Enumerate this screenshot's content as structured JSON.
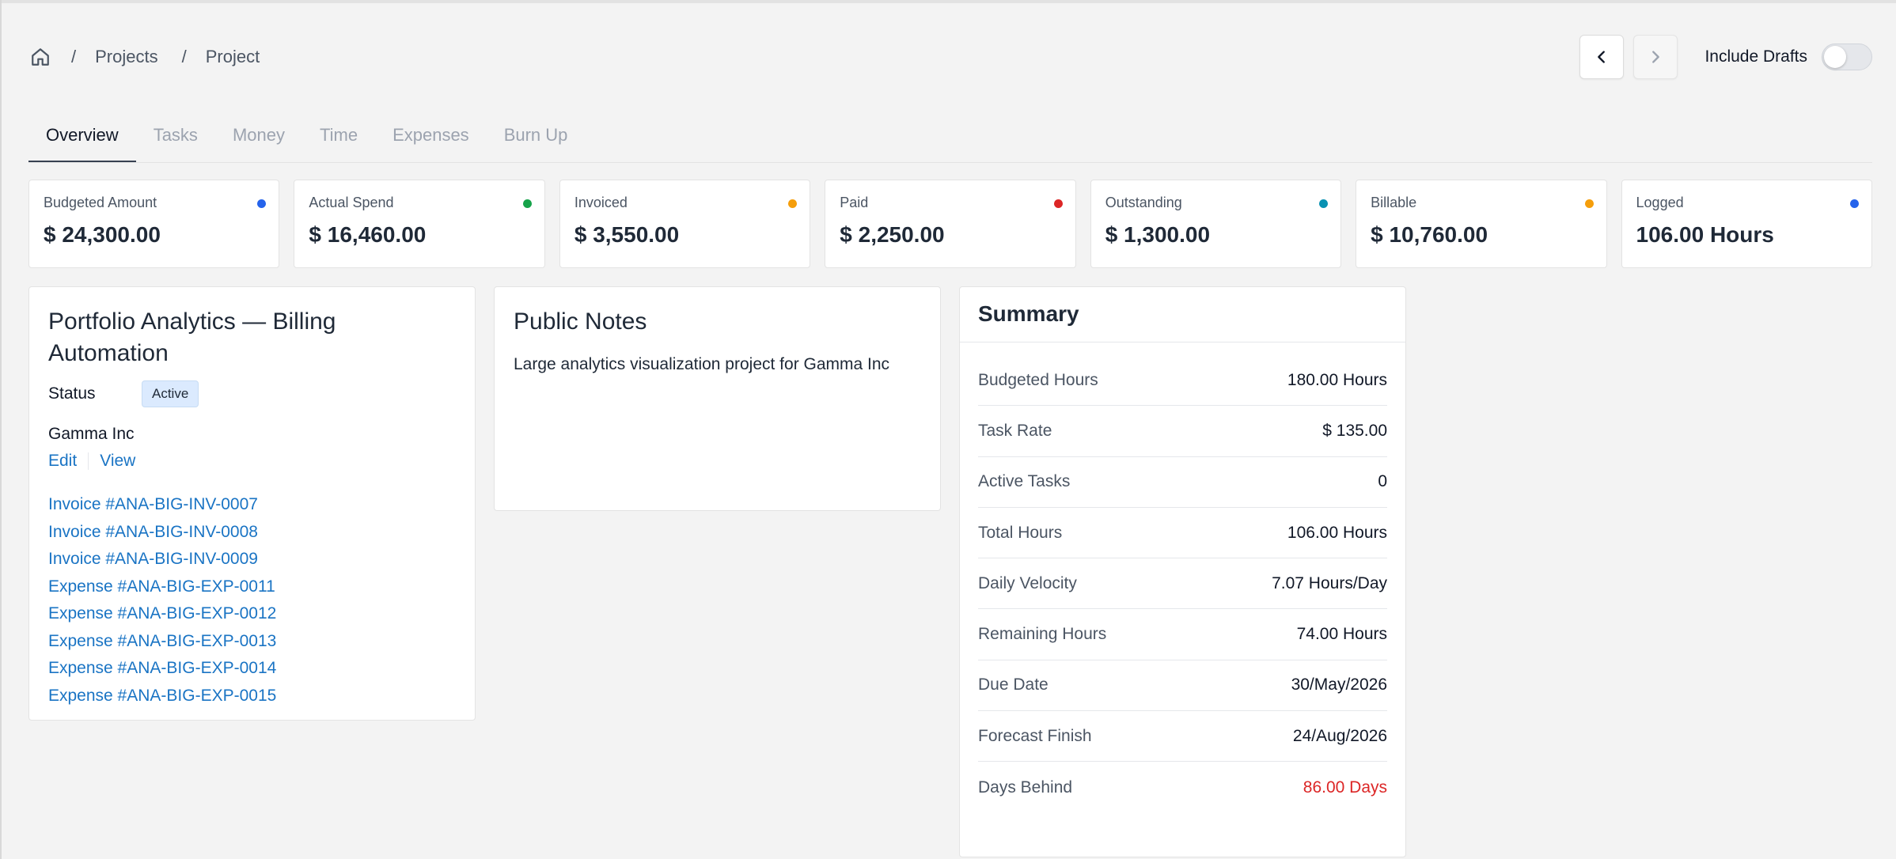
{
  "breadcrumb": {
    "home_icon": "home-icon",
    "separator": "/",
    "projects": "Projects",
    "current": "Project"
  },
  "header": {
    "prev_icon": "chevron-left-icon",
    "next_icon": "chevron-right-icon",
    "include_drafts_label": "Include Drafts",
    "include_drafts_on": false
  },
  "tabs": [
    {
      "label": "Overview",
      "active": true
    },
    {
      "label": "Tasks",
      "active": false
    },
    {
      "label": "Money",
      "active": false
    },
    {
      "label": "Time",
      "active": false
    },
    {
      "label": "Expenses",
      "active": false
    },
    {
      "label": "Burn Up",
      "active": false
    }
  ],
  "stats": [
    {
      "label": "Budgeted Amount",
      "value": "$ 24,300.00",
      "dot_color": "#2563eb"
    },
    {
      "label": "Actual Spend",
      "value": "$ 16,460.00",
      "dot_color": "#16a34a"
    },
    {
      "label": "Invoiced",
      "value": "$ 3,550.00",
      "dot_color": "#f59e0b"
    },
    {
      "label": "Paid",
      "value": "$ 2,250.00",
      "dot_color": "#dc2626"
    },
    {
      "label": "Outstanding",
      "value": "$ 1,300.00",
      "dot_color": "#0891b2"
    },
    {
      "label": "Billable",
      "value": "$ 10,760.00",
      "dot_color": "#f59e0b"
    },
    {
      "label": "Logged",
      "value": "106.00 Hours",
      "dot_color": "#2563eb"
    }
  ],
  "project": {
    "title": "Portfolio Analytics — Billing Automation",
    "status_label": "Status",
    "status_value": "Active",
    "client": "Gamma Inc",
    "edit_label": "Edit",
    "view_label": "View",
    "links": [
      "Invoice #ANA-BIG-INV-0007",
      "Invoice #ANA-BIG-INV-0008",
      "Invoice #ANA-BIG-INV-0009",
      "Expense #ANA-BIG-EXP-0011",
      "Expense #ANA-BIG-EXP-0012",
      "Expense #ANA-BIG-EXP-0013",
      "Expense #ANA-BIG-EXP-0014",
      "Expense #ANA-BIG-EXP-0015"
    ]
  },
  "notes": {
    "title": "Public Notes",
    "text": "Large analytics visualization project for Gamma Inc"
  },
  "summary": {
    "title": "Summary",
    "rows": [
      {
        "key": "Budgeted Hours",
        "value": "180.00 Hours"
      },
      {
        "key": "Task Rate",
        "value": "$ 135.00"
      },
      {
        "key": "Active Tasks",
        "value": "0"
      },
      {
        "key": "Total Hours",
        "value": "106.00 Hours"
      },
      {
        "key": "Daily Velocity",
        "value": "7.07 Hours/Day"
      },
      {
        "key": "Remaining Hours",
        "value": "74.00 Hours"
      },
      {
        "key": "Due Date",
        "value": "30/May/2026"
      },
      {
        "key": "Forecast Finish",
        "value": "24/Aug/2026"
      },
      {
        "key": "Days Behind",
        "value": "86.00 Days"
      }
    ],
    "danger_color": "#dc2626"
  }
}
